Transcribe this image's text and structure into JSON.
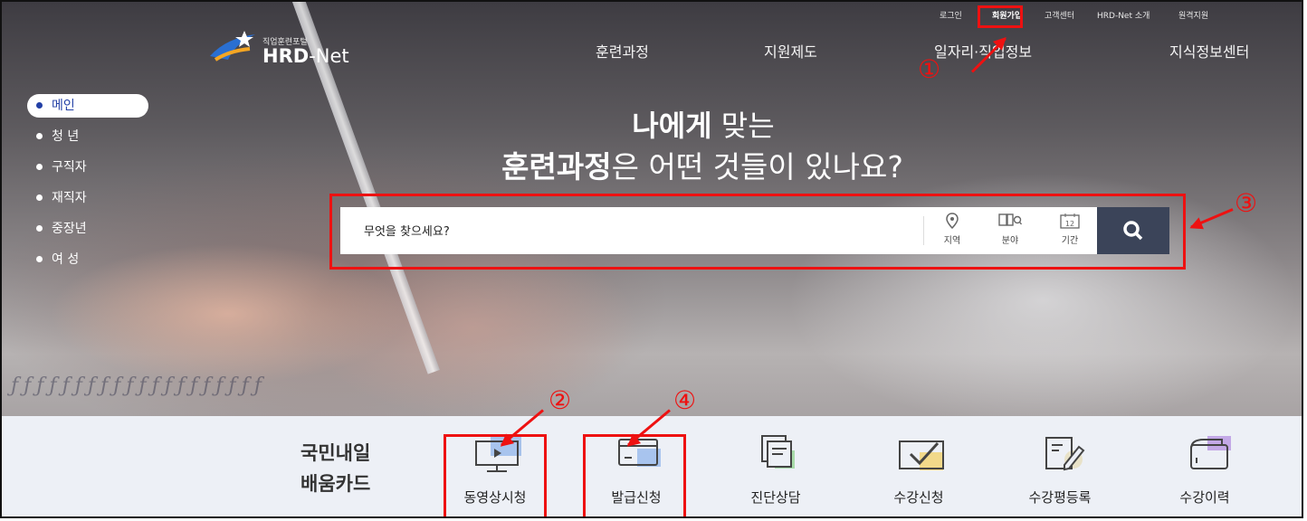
{
  "util_links": [
    "로그인",
    "회원가입",
    "고객센터",
    "HRD-Net 소개",
    "원격지원"
  ],
  "logo": {
    "small": "직업훈련포털",
    "big_a": "HRD",
    "big_b": "-Net"
  },
  "nav": [
    "훈련과정",
    "지원제도",
    "일자리·직업정보",
    "지식정보센터"
  ],
  "side_menu": [
    "메인",
    "청 년",
    "구직자",
    "재직자",
    "중장년",
    "여 성"
  ],
  "headline": {
    "line1_bold": "나에게",
    "line1_rest": " 맞는",
    "line2_bold": "훈련과정",
    "line2_rest": "은 어떤 것들이 있나요?"
  },
  "search": {
    "placeholder": "무엇을 찾으세요?",
    "filters": [
      "지역",
      "분야",
      "기간"
    ],
    "calendar_number": "12"
  },
  "markers": [
    "①",
    "②",
    "③",
    "④"
  ],
  "card": {
    "title_line1": "국민내일",
    "title_line2": "배움카드"
  },
  "quick_items": [
    "동영상시청",
    "발급신청",
    "진단상담",
    "수강신청",
    "수강평등록",
    "수강이력"
  ],
  "colors": {
    "highlight": "#ee1111",
    "search_button": "#3b4459",
    "active_menu": "#2340a6"
  }
}
